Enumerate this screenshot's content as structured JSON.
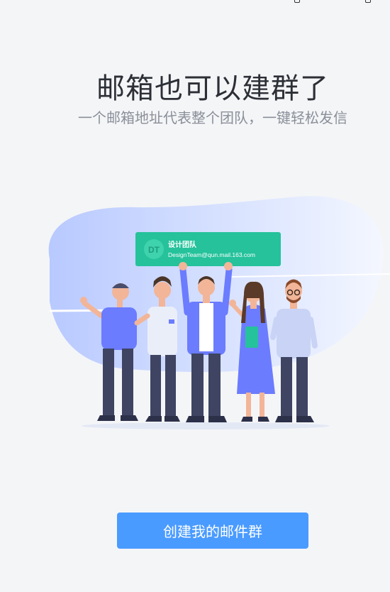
{
  "page": {
    "title": "邮箱也可以建群了",
    "subtitle": "一个邮箱地址代表整个团队，一键轻松发信"
  },
  "illustration": {
    "card": {
      "avatar_initials": "DT",
      "group_name": "设计团队",
      "group_email": "DesignTeam@qun.mail.163.com"
    }
  },
  "actions": {
    "create_button": "创建我的邮件群"
  },
  "colors": {
    "background": "#f4f5f7",
    "primary_button": "#4a9bff",
    "card_green": "#25c29b",
    "blob_blue": "#c7d6ff"
  }
}
